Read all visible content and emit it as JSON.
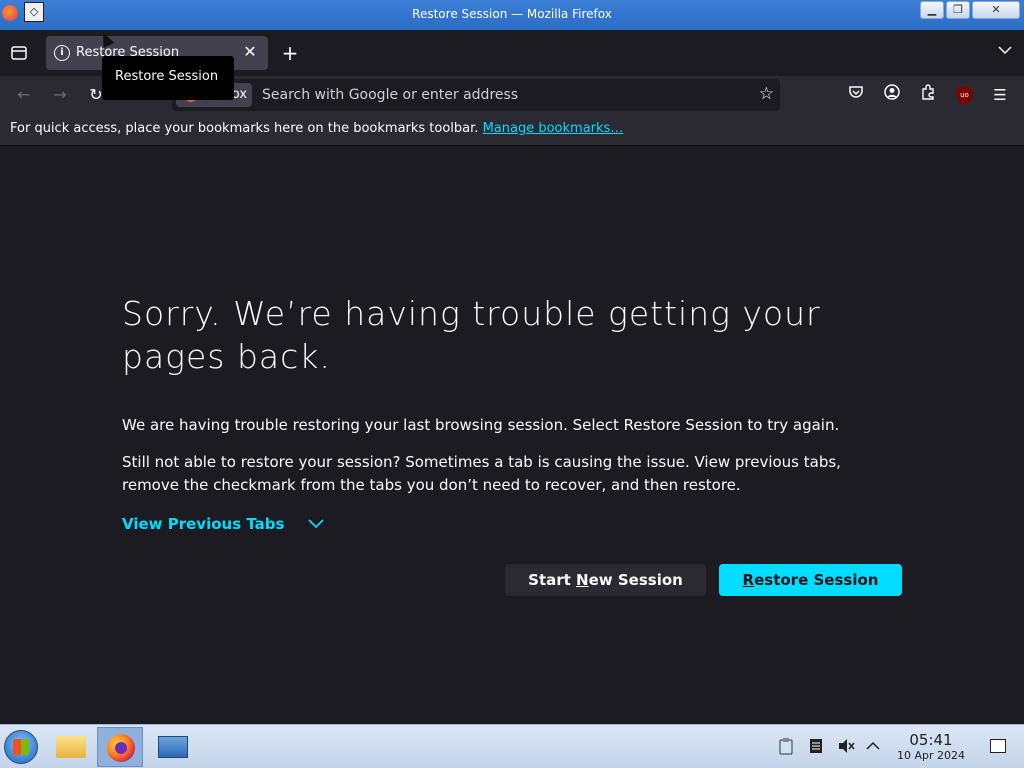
{
  "window": {
    "title": "Restore Session — Mozilla Firefox",
    "minimize_label": "▁",
    "maximize_label": "❐",
    "close_label": "✕"
  },
  "tabs": [
    {
      "label": "Restore Session",
      "active": true
    }
  ],
  "tooltip": "Restore Session",
  "navbar": {
    "identity_label": "Firefox",
    "url_placeholder": "Search with Google or enter address",
    "ublock_label": "uo"
  },
  "bookmarks_bar": {
    "text": "For quick access, place your bookmarks here on the bookmarks toolbar.",
    "link": "Manage bookmarks…"
  },
  "content": {
    "heading": "Sorry. We’re having trouble getting your pages back.",
    "para1": "We are having trouble restoring your last browsing session. Select Restore Session to try again.",
    "para2": "Still not able to restore your session? Sometimes a tab is causing the issue. View previous tabs, remove the checkmark from the tabs you don’t need to recover, and then restore.",
    "view_previous": "View Previous Tabs",
    "new_session_button": {
      "before": "Start ",
      "accel": "N",
      "after": "ew Session"
    },
    "restore_button": {
      "accel": "R",
      "after": "estore Session"
    }
  },
  "taskbar": {
    "time": "05:41",
    "date": "10 Apr 2024"
  },
  "colors": {
    "accent": "#00ddff",
    "page_bg": "#1c1b22",
    "toolbar_bg": "#2b2a33"
  }
}
